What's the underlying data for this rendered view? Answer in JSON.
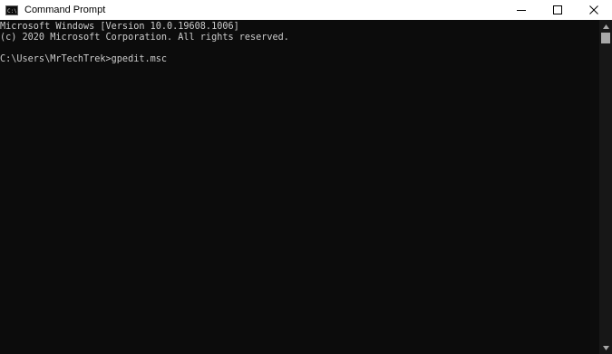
{
  "window": {
    "title": "Command Prompt",
    "icon": "console-app-icon"
  },
  "caption_buttons": {
    "minimize_icon": "minimize-icon",
    "maximize_icon": "maximize-icon",
    "close_icon": "close-icon"
  },
  "console": {
    "lines": [
      "Microsoft Windows [Version 10.0.19608.1006]",
      "(c) 2020 Microsoft Corporation. All rights reserved.",
      "",
      "C:\\Users\\MrTechTrek>gpedit.msc"
    ]
  },
  "colors": {
    "console_background": "#0c0c0c",
    "console_text": "#cccccc",
    "titlebar_background": "#ffffff"
  }
}
